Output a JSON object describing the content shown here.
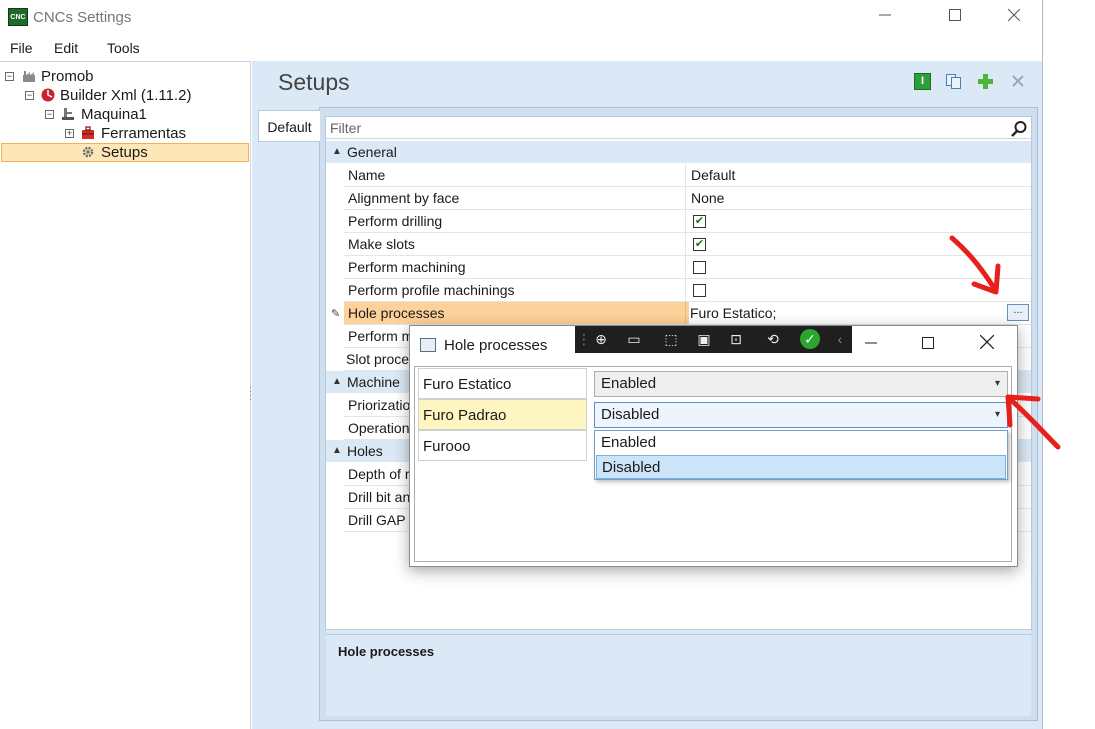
{
  "window": {
    "title": "CNCs Settings",
    "icon_label": "CNC"
  },
  "menu": [
    "File",
    "Edit",
    "Tools"
  ],
  "tree": {
    "items": [
      {
        "label": "Promob",
        "level": 0,
        "icon": "factory-icon"
      },
      {
        "label": "Builder Xml (1.11.2)",
        "level": 1,
        "icon": "builder-icon"
      },
      {
        "label": "Maquina1",
        "level": 2,
        "icon": "machine-icon"
      },
      {
        "label": "Ferramentas",
        "level": 3,
        "icon": "toolbox-icon"
      },
      {
        "label": "Setups",
        "level": 4,
        "icon": "gear-icon"
      }
    ],
    "selected": "Setups"
  },
  "main": {
    "title": "Setups",
    "toolbar": [
      "info-icon",
      "copy-icon",
      "add-icon",
      "delete-icon"
    ],
    "tab": "Default",
    "filter_placeholder": "Filter",
    "categories": {
      "general": "General",
      "machine": "Machine",
      "holes": "Holes"
    },
    "general_rows": [
      {
        "name": "Name",
        "value": "Default"
      },
      {
        "name": "Alignment by face",
        "value": "None"
      },
      {
        "name": "Perform drilling",
        "checked": true
      },
      {
        "name": "Make slots",
        "checked": true
      },
      {
        "name": "Perform machining",
        "checked": false
      },
      {
        "name": "Perform profile machinings",
        "checked": false
      },
      {
        "name": "Hole processes",
        "value": "Furo Estatico;"
      },
      {
        "name": "Perform m"
      },
      {
        "name": "Slot proce"
      }
    ],
    "machine_rows": [
      {
        "name": "Priorizatio"
      },
      {
        "name": "Operation"
      }
    ],
    "holes_rows": [
      {
        "name": "Depth of r"
      },
      {
        "name": "Drill bit an"
      },
      {
        "name": "Drill GAP I"
      }
    ],
    "ellipsis_label": "...",
    "help_title": "Hole processes"
  },
  "dialog": {
    "title": "Hole processes",
    "rows": [
      {
        "name": "Furo Estatico",
        "value": "Enabled"
      },
      {
        "name": "Furo Padrao",
        "value": "Disabled"
      },
      {
        "name": "Furooo",
        "value": ""
      }
    ],
    "dropdown_options": [
      "Enabled",
      "Disabled"
    ],
    "dropdown_selected": "Disabled"
  },
  "colors": {
    "selection": "#fdd19a",
    "panel": "#dbe8f6",
    "annotation_arrow": "#e8201c"
  }
}
